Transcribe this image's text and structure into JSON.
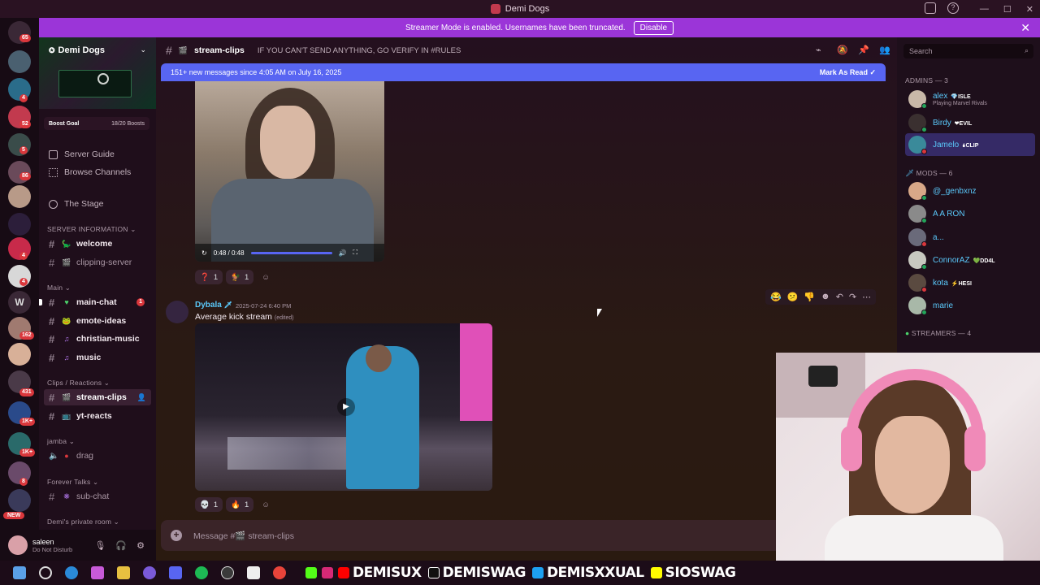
{
  "window": {
    "title": "Demi Dogs"
  },
  "banner": {
    "text": "Streamer Mode is enabled. Usernames have been truncated.",
    "button": "Disable"
  },
  "rail": {
    "badges": [
      "65",
      "4",
      "52",
      "5",
      "86",
      "4",
      "4",
      "162",
      "431",
      "1K+",
      "1K+",
      "8"
    ],
    "new_label": "NEW",
    "letter": "W"
  },
  "server": {
    "name": "Demi Dogs",
    "boost_label": "Boost Goal",
    "boost_value": "18/20 Boosts",
    "nav": [
      "Server Guide",
      "Browse Channels",
      "The Stage"
    ]
  },
  "categories": {
    "server_info": "SERVER INFORMATION",
    "main": "Main",
    "clips": "Clips / Reactions",
    "jamba": "jamba",
    "forever": "Forever Talks",
    "private": "Demi's private room"
  },
  "channels": {
    "welcome": "welcome",
    "clipping": "clipping-server",
    "main_chat": "main-chat",
    "main_chat_unread": "1",
    "emote_ideas": "emote-ideas",
    "christian_music": "christian-music",
    "music": "music",
    "stream_clips": "stream-clips",
    "yt_reacts": "yt-reacts",
    "drag": "drag",
    "sub_chat": "sub-chat"
  },
  "user": {
    "name": "saleen",
    "status": "Do Not Disturb"
  },
  "header": {
    "channel": "stream-clips",
    "topic": "IF YOU CAN'T SEND ANYTHING, GO VERIFY IN #RULES"
  },
  "newbar": {
    "text": "151+ new messages since 4:05 AM on July 16, 2025",
    "action": "Mark As Read"
  },
  "video1": {
    "time": "0:48 / 0:48",
    "progress": 1.0
  },
  "reactions1": [
    {
      "emoji": "❓",
      "count": "1"
    },
    {
      "emoji": "🐓",
      "count": "1"
    }
  ],
  "message2": {
    "author": "Dybala",
    "timestamp": "2025-07-24 6:40 PM",
    "text": "Average kick stream",
    "edited": "(edited)"
  },
  "reactions2": [
    {
      "emoji": "💀",
      "count": "1"
    },
    {
      "emoji": "🔥",
      "count": "1"
    }
  ],
  "msg_actions": [
    "😂",
    "😕",
    "👎",
    "☻",
    "↶",
    "↷",
    "⋯"
  ],
  "composer": {
    "placeholder": "Message #🎬 stream-clips"
  },
  "search": {
    "placeholder": "Search"
  },
  "members": {
    "admins_label": "ADMINS — 3",
    "admins": [
      {
        "name": "alex",
        "tag": "💎ISLE",
        "activity": "Playing Marvel Rivals",
        "color": "#5ac8fa"
      },
      {
        "name": "Birdy",
        "tag": "❤EVIL",
        "activity": "",
        "color": "#5ac8fa"
      },
      {
        "name": "Jamelo",
        "tag": "🌢CLIP",
        "activity": "",
        "color": "#5ac8fa"
      }
    ],
    "mods_label": "MODS — 6",
    "mods": [
      {
        "name": "@_genbxnz",
        "tag": "",
        "color": "#5ac8fa"
      },
      {
        "name": "A A RON",
        "tag": "",
        "color": "#5ac8fa"
      },
      {
        "name": "a...",
        "tag": "",
        "color": "#5ac8fa"
      },
      {
        "name": "ConnorAZ",
        "tag": "💚DD4L",
        "color": "#5ac8fa"
      },
      {
        "name": "kota",
        "tag": "⚡HESI",
        "color": "#5ac8fa"
      },
      {
        "name": "marie",
        "tag": "",
        "color": "#5ac8fa"
      }
    ],
    "streamers_label": "STREAMERS — 4"
  },
  "taskbar": {
    "handles": [
      "DEMISUX",
      "DEMISWAG",
      "DEMISXXUAL",
      "SIOSWAG"
    ]
  },
  "colors": {
    "accent": "#9b35d8",
    "blurple": "#5865f2",
    "dnd": "#da373c"
  }
}
